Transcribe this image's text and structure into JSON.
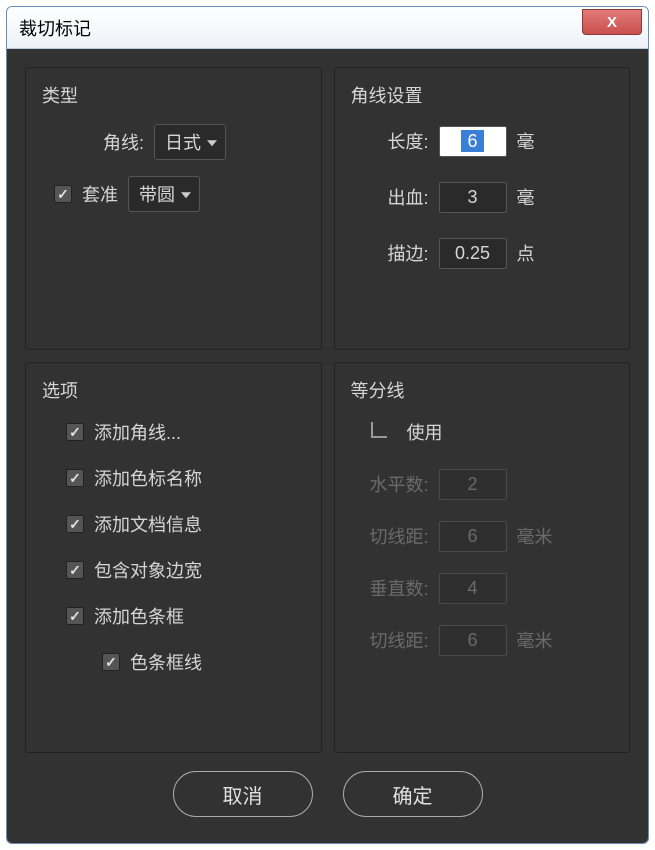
{
  "window": {
    "title": "裁切标记",
    "close": "X"
  },
  "type_panel": {
    "title": "类型",
    "corner_label": "角线:",
    "corner_value": "日式",
    "register_label": "套准",
    "register_value": "带圆"
  },
  "corner_settings": {
    "title": "角线设置",
    "length_label": "长度:",
    "length_value": "6",
    "length_unit": "毫",
    "bleed_label": "出血:",
    "bleed_value": "3",
    "bleed_unit": "毫",
    "stroke_label": "描边:",
    "stroke_value": "0.25",
    "stroke_unit": "点"
  },
  "options": {
    "title": "选项",
    "items": [
      "添加角线...",
      "添加色标名称",
      "添加文档信息",
      "包含对象边宽",
      "添加色条框"
    ],
    "sub_item": "色条框线"
  },
  "dividers": {
    "title": "等分线",
    "use_label": "使用",
    "h_count_label": "水平数:",
    "h_count_value": "2",
    "h_gap_label": "切线距:",
    "h_gap_value": "6",
    "h_gap_unit": "毫米",
    "v_count_label": "垂直数:",
    "v_count_value": "4",
    "v_gap_label": "切线距:",
    "v_gap_value": "6",
    "v_gap_unit": "毫米"
  },
  "buttons": {
    "cancel": "取消",
    "ok": "确定"
  }
}
